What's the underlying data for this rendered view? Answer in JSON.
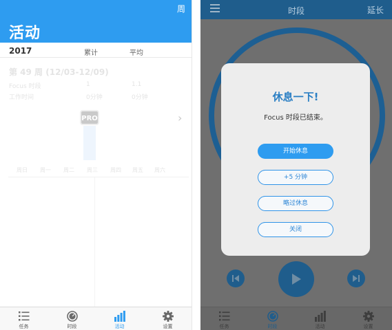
{
  "left": {
    "header": {
      "week_button": "周",
      "title": "活动"
    },
    "columns": {
      "year": "2017",
      "cumulative": "累计",
      "average": "平均"
    },
    "week_range": "第 49 周 (12/03-12/09)",
    "rows": [
      {
        "label": "Focus 时段",
        "cumulative": "1",
        "average": "1.1"
      },
      {
        "label": "工作时间",
        "cumulative": "0分钟",
        "average": "0分钟"
      }
    ],
    "pro_badge": "PRO",
    "weekdays": [
      "周日",
      "周一",
      "周二",
      "周三",
      "周四",
      "周五",
      "周六"
    ],
    "tabs": [
      {
        "label": "任务",
        "icon": "list-icon"
      },
      {
        "label": "时段",
        "icon": "timer-icon"
      },
      {
        "label": "活动",
        "icon": "bar-chart-icon",
        "active": true
      },
      {
        "label": "设置",
        "icon": "gear-icon"
      }
    ],
    "colors": {
      "accent": "#2e9cf0",
      "tab_inactive": "#6a6a6a"
    }
  },
  "right": {
    "header": {
      "title": "时段",
      "extend": "延长"
    },
    "dialog": {
      "title": "休息一下!",
      "message": "Focus 时段已结束。",
      "buttons": [
        "开始休息",
        "+5 分钟",
        "略过休息",
        "关闭"
      ]
    },
    "tabs": [
      {
        "label": "任务",
        "icon": "list-icon"
      },
      {
        "label": "时段",
        "icon": "timer-icon",
        "active": true
      },
      {
        "label": "活动",
        "icon": "bar-chart-icon"
      },
      {
        "label": "设置",
        "icon": "gear-icon"
      }
    ],
    "colors": {
      "dim_blue": "#1f5d8c",
      "dialog_accent": "#2e9cf0"
    }
  }
}
